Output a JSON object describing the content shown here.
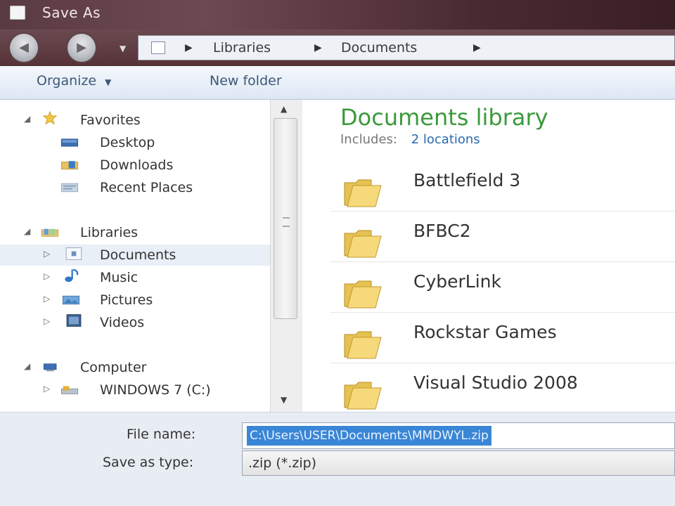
{
  "window": {
    "title": "Save As"
  },
  "address": {
    "crumbs": [
      "Libraries",
      "Documents"
    ]
  },
  "toolbar": {
    "organize": "Organize",
    "new_folder": "New folder"
  },
  "navpane": {
    "favorites": {
      "label": "Favorites",
      "items": [
        {
          "label": "Desktop",
          "icon": "desktop-icon"
        },
        {
          "label": "Downloads",
          "icon": "downloads-icon"
        },
        {
          "label": "Recent Places",
          "icon": "recent-places-icon"
        }
      ]
    },
    "libraries": {
      "label": "Libraries",
      "items": [
        {
          "label": "Documents",
          "icon": "documents-icon"
        },
        {
          "label": "Music",
          "icon": "music-icon"
        },
        {
          "label": "Pictures",
          "icon": "pictures-icon"
        },
        {
          "label": "Videos",
          "icon": "videos-icon"
        }
      ]
    },
    "computer": {
      "label": "Computer",
      "items": [
        {
          "label": "WINDOWS 7 (C:)",
          "icon": "drive-icon"
        }
      ]
    }
  },
  "content": {
    "title": "Documents library",
    "includes_label": "Includes:",
    "includes_link": "2 locations",
    "folders": [
      "Battlefield 3",
      "BFBC2",
      "CyberLink",
      "Rockstar Games",
      "Visual Studio 2008"
    ]
  },
  "bottom": {
    "file_name_label": "File name:",
    "file_name_value": "C:\\Users\\USER\\Documents\\MMDWYL.zip",
    "save_type_label": "Save as type:",
    "save_type_value": ".zip (*.zip)"
  },
  "colors": {
    "library_title": "#3a9a3a",
    "link": "#2a6bb0",
    "selection": "#3a86d6"
  }
}
